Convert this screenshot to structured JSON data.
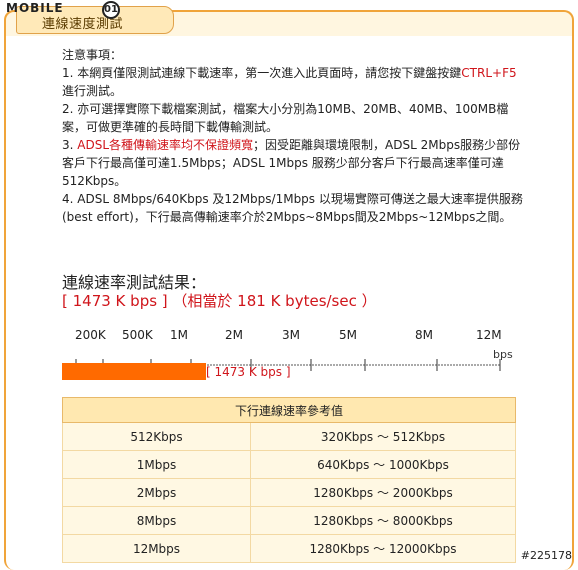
{
  "logo": {
    "text": "MOBILE",
    "mark": "01"
  },
  "tab": {
    "title": "連線速度測試"
  },
  "notes": {
    "heading": "注意事項：",
    "item1_a": "1. 本網頁僅限測試連線下載速率，第一次進入此頁面時，請您按下鍵盤按鍵",
    "item1_red": "CTRL+F5",
    "item1_b": " 進行測試。",
    "item2": "2. 亦可選擇實際下載檔案測試，檔案大小分別為10MB、20MB、40MB、100MB檔案，可做更準確的長時間下載傳輸測試。",
    "item3_a": "3. ",
    "item3_red": "ADSL各種傳輸速率均不保證頻寬",
    "item3_b": "；因受距離與環境限制，ADSL 2Mbps服務少部份客戶下行最高僅可達1.5Mbps；ADSL 1Mbps 服務少部分客戶下行最高速率僅可達512Kbps。",
    "item4": "4. ADSL 8Mbps/640Kbps 及12Mbps/1Mbps 以現場實際可傳送之最大速率提供服務(best effort)，下行最高傳輸速率介於2Mbps~8Mbps間及2Mbps~12Mbps之間。"
  },
  "result": {
    "title": "連線速率測試結果：",
    "value_text": "[ 1473 K bps ] （相當於 181 K bytes/sec ）",
    "bar_label": "[ 1473 K bps ]",
    "bar_fraction": 0.339,
    "bar_color": "#ff6a00"
  },
  "scale": {
    "labels": [
      "200K",
      "500K",
      "1M",
      "2M",
      "3M",
      "5M",
      "8M",
      "12M"
    ],
    "ruler": "|-----|--------|---------|------------|-----------|--------------|---------------|--------------|",
    "unit": "bps"
  },
  "table": {
    "header": "下行連線速率參考值",
    "rows": [
      {
        "plan": "512Kbps",
        "range": "320Kbps ～ 512Kbps"
      },
      {
        "plan": "1Mbps",
        "range": "640Kbps ～ 1000Kbps"
      },
      {
        "plan": "2Mbps",
        "range": "1280Kbps ～ 2000Kbps"
      },
      {
        "plan": "8Mbps",
        "range": "1280Kbps ～ 8000Kbps"
      },
      {
        "plan": "12Mbps",
        "range": "1280Kbps ～ 12000Kbps"
      }
    ]
  },
  "watermark": "#225178",
  "colors": {
    "accent": "#f0a43a",
    "red": "#d0151b",
    "table_header": "#ffe8b0",
    "table_cell": "#fff8e3"
  }
}
